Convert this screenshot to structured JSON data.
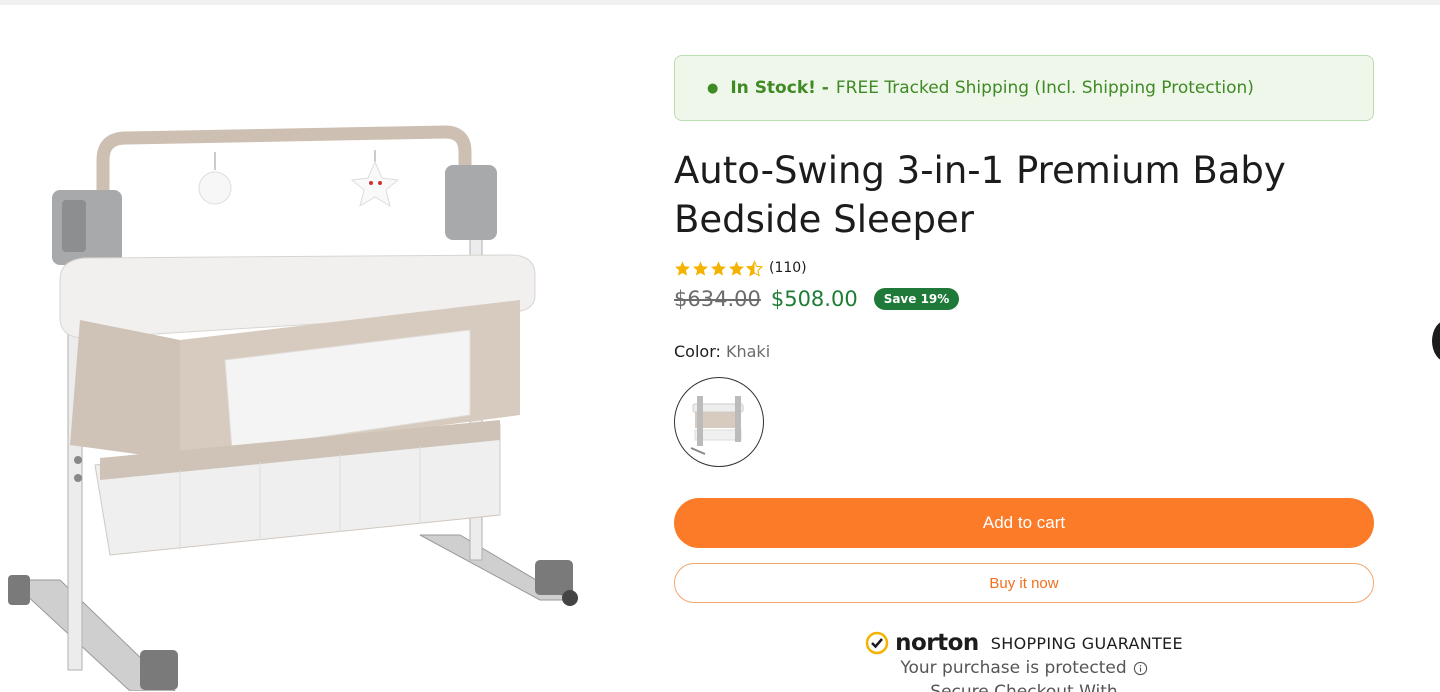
{
  "stock_banner": {
    "status": "In Stock! -",
    "message": "FREE Tracked Shipping (Incl. Shipping Protection)"
  },
  "product": {
    "title": "Auto-Swing 3-in-1 Premium Baby Bedside Sleeper",
    "rating": 4.5,
    "review_count": "(110)",
    "compare_price": "$634.00",
    "price": "$508.00",
    "save_badge": "Save 19%",
    "color_label": "Color:",
    "color_value": "Khaki"
  },
  "buttons": {
    "add_to_cart": "Add to cart",
    "buy_now": "Buy it now"
  },
  "norton": {
    "brand": "norton",
    "guarantee": "SHOPPING GUARANTEE",
    "protected": "Your purchase is protected",
    "cut_text": "Secure Checkout With"
  },
  "colors": {
    "accent": "#fb7b29",
    "price_green": "#1e7d35",
    "stock_green": "#3f8a24",
    "badge": "#1f7a3a",
    "star": "#f5b301"
  },
  "icons": [
    "check-icon",
    "info-icon",
    "star-icon",
    "next-arrow-icon"
  ]
}
